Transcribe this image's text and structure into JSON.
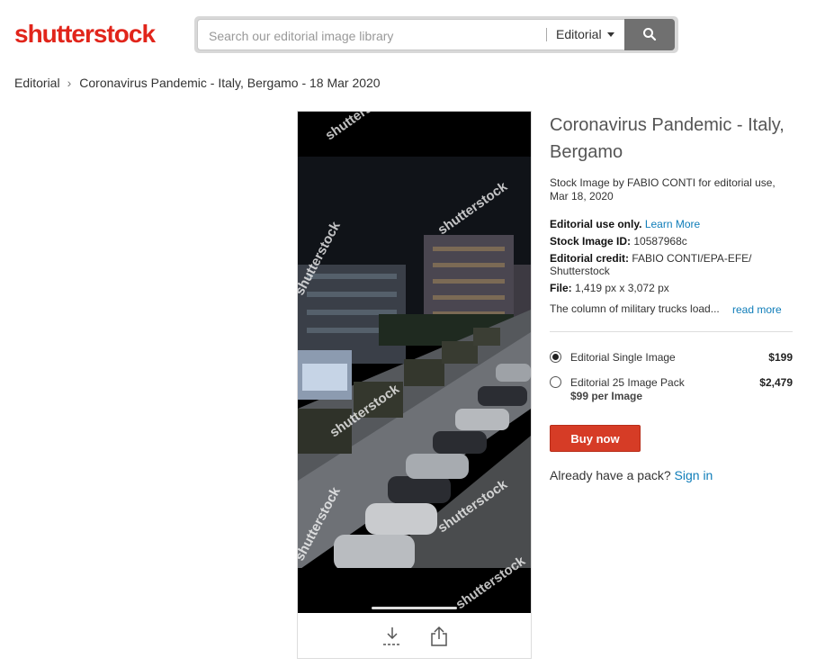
{
  "header": {
    "logo": "shutterstock",
    "search_placeholder": "Search our editorial image library",
    "filter_label": "Editorial"
  },
  "breadcrumb": {
    "root": "Editorial",
    "current": "Coronavirus Pandemic - Italy, Bergamo - 18 Mar 2020"
  },
  "image": {
    "watermark": "shutterstock"
  },
  "details": {
    "title": "Coronavirus Pandemic - Italy, Bergamo",
    "byline": "Stock Image by FABIO CONTI for editorial use, Mar 18, 2020",
    "use_label": "Editorial use only.",
    "learn_more": "Learn More",
    "id_label": "Stock Image ID:",
    "id_value": "10587968c",
    "credit_label": "Editorial credit:",
    "credit_value": "FABIO CONTI/EPA-EFE/ Shutterstock",
    "file_label": "File:",
    "file_value": "1,419 px x 3,072 px",
    "description": "The column of military trucks load...",
    "read_more": "read more"
  },
  "pricing": {
    "options": [
      {
        "label": "Editorial Single Image",
        "sub": "",
        "price": "$199",
        "selected": true
      },
      {
        "label": "Editorial 25 Image Pack",
        "sub": "$99 per Image",
        "price": "$2,479",
        "selected": false
      }
    ],
    "buy_label": "Buy now",
    "pack_text": "Already have a pack?",
    "sign_in": "Sign in"
  },
  "colors": {
    "brand": "#e1251b",
    "link": "#0f7db9",
    "buy": "#d63c26"
  }
}
